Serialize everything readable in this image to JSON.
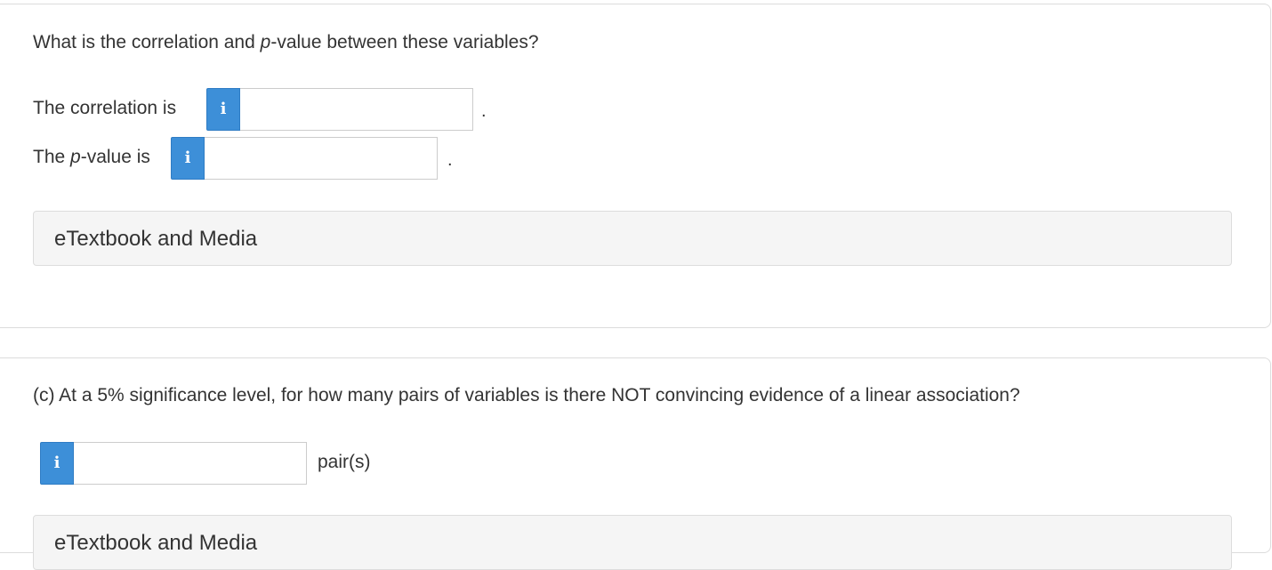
{
  "question_b": {
    "prompt_before": "What is the correlation and ",
    "prompt_italic": "p",
    "prompt_after": "-value between these variables?",
    "correlation": {
      "label": "The correlation is",
      "info_icon": "i",
      "value": "",
      "suffix": "."
    },
    "pvalue": {
      "label_before": "The ",
      "label_italic": "p",
      "label_after": "-value is",
      "info_icon": "i",
      "value": "",
      "suffix": "."
    },
    "media_label": "eTextbook and Media"
  },
  "question_c": {
    "prompt": "(c) At a 5% significance level, for how many pairs of variables is there NOT convincing evidence of a linear association?",
    "answer": {
      "info_icon": "i",
      "value": "",
      "unit": "pair(s)"
    },
    "media_label": "eTextbook and Media"
  },
  "colors": {
    "info_button": "#3d8fd8",
    "text": "#333333",
    "panel_bg": "#f5f5f5"
  }
}
